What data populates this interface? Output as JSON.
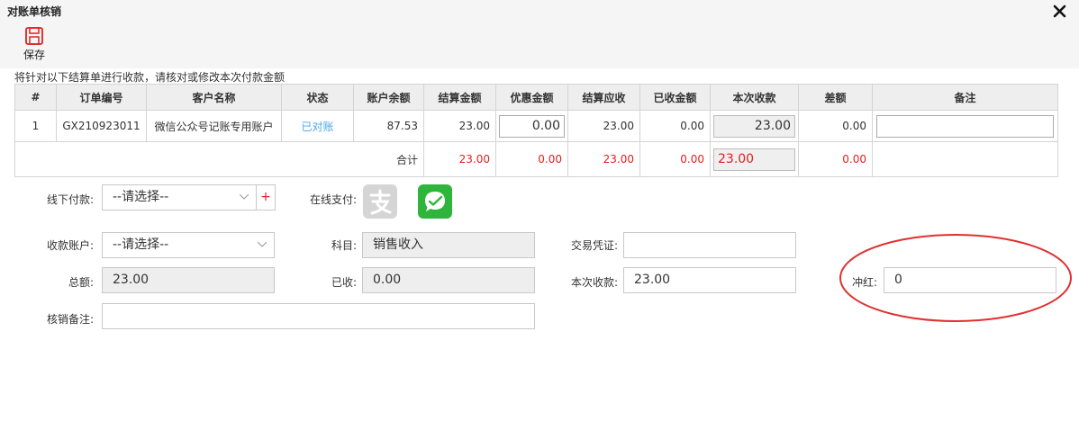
{
  "window": {
    "title": "对账单核销"
  },
  "toolbar": {
    "save_label": "保存"
  },
  "hint": "将针对以下结算单进行收款，请核对或修改本次付款金额",
  "table": {
    "headers": [
      "#",
      "订单编号",
      "客户名称",
      "状态",
      "账户余额",
      "结算金额",
      "优惠金额",
      "结算应收",
      "已收金额",
      "本次收款",
      "差额",
      "备注"
    ],
    "row": {
      "index": "1",
      "order_no": "GX210923011",
      "customer": "微信公众号记账专用账户",
      "status": "已对账",
      "balance": "87.53",
      "settle_amount": "23.00",
      "discount": "0.00",
      "receivable": "23.00",
      "received": "0.00",
      "this_payment": "23.00",
      "difference": "0.00",
      "remark": ""
    },
    "total": {
      "label": "合计",
      "settle_amount": "23.00",
      "discount": "0.00",
      "receivable": "23.00",
      "received": "0.00",
      "this_payment": "23.00",
      "difference": "0.00"
    }
  },
  "form": {
    "offline_pay_label": "线下付款:",
    "offline_pay_value": "--请选择--",
    "plus": "+",
    "online_pay_label": "在线支付:",
    "account_label": "收款账户:",
    "account_value": "--请选择--",
    "subject_label": "科目:",
    "subject_value": "销售收入",
    "voucher_label": "交易凭证:",
    "voucher_value": "",
    "total_label": "总额:",
    "total_value": "23.00",
    "received_label": "已收:",
    "received_value": "0.00",
    "this_payment_label": "本次收款:",
    "this_payment_value": "23.00",
    "reverse_label": "冲红:",
    "reverse_value": "0",
    "remark_label": "核销备注:",
    "remark_value": ""
  },
  "colors": {
    "accent_red": "#e02020",
    "link_blue": "#4aa8e8",
    "wechat_green": "#2fb53b",
    "header_gray": "#eeeeee"
  },
  "icons": {
    "save": "save-icon",
    "close": "close-icon",
    "alipay": "alipay-icon",
    "wechat": "wechat-pay-icon"
  }
}
